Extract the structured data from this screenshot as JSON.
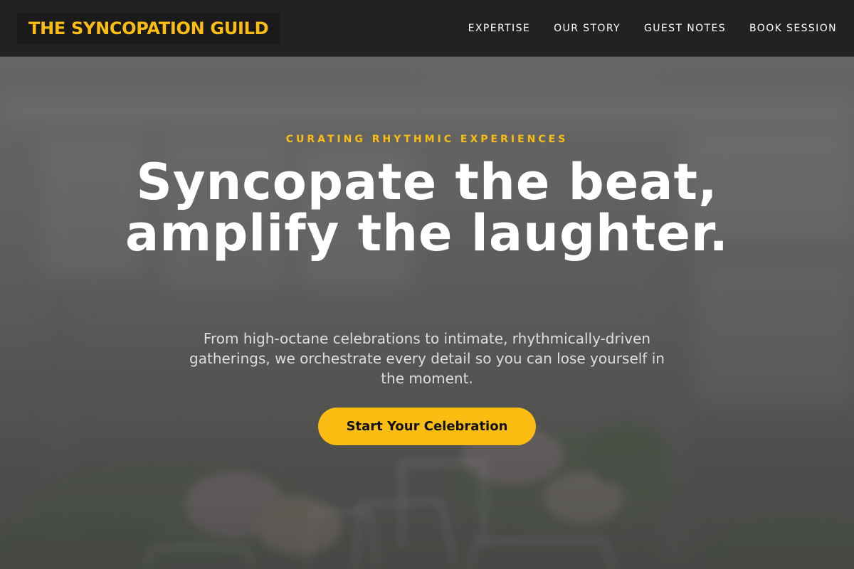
{
  "header": {
    "logo": "THE SYNCOPATION GUILD",
    "nav": [
      {
        "label": "EXPERTISE"
      },
      {
        "label": "OUR STORY"
      },
      {
        "label": "GUEST NOTES"
      },
      {
        "label": "BOOK SESSION"
      }
    ]
  },
  "hero": {
    "kicker": "CURATING RHYTHMIC EXPERIENCES",
    "headline": "Syncopate the beat, amplify the laughter.",
    "subcopy": "From high-octane celebrations to intimate, rhythmically-driven gatherings, we orchestrate every detail so you can lose yourself in the moment.",
    "cta_label": "Start Your Celebration",
    "background_image": "blurred-event-table-with-glassware-and-floral-arrangements"
  },
  "colors": {
    "accent": "#fcbd12",
    "header_bg": "#222222",
    "text_light": "#ffffff"
  }
}
